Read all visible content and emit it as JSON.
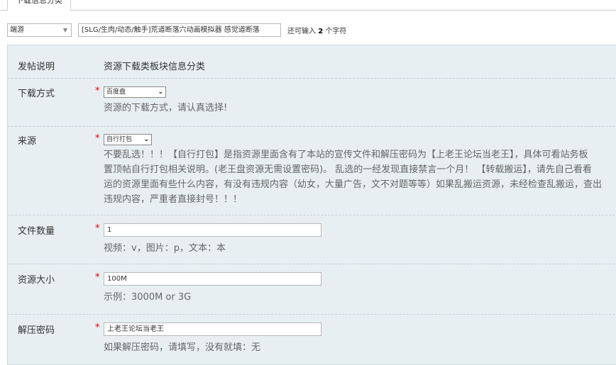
{
  "tab": {
    "label": "下载信息分类"
  },
  "title_row": {
    "type_select": "端游",
    "title_value": "[SLG/生肉/动态/触手]荒道断落穴动画模拟器 感觉道断落",
    "counter_prefix": "还可输入",
    "counter_num": "2",
    "counter_suffix": "个字符"
  },
  "form": {
    "post_desc": {
      "label": "发帖说明",
      "value": "资源下载类板块信息分类"
    },
    "download_method": {
      "label": "下载方式",
      "required": "*",
      "selected": "百度盘",
      "hint": "资源的下载方式，请认真选择!"
    },
    "source": {
      "label": "来源",
      "required": "*",
      "selected": "自行打包",
      "hint_lines": [
        "不要乱选！！！【自行打包】是指资源里面含有了本站的宣传文件和解压密码为【上老王论坛当老王】，具体可看站务板",
        "置顶帖自行打包相关说明。(老王盘资源无需设置密码)。 乱选的一经发现直接禁言一个月！ 【转载搬运】，请先自己看看",
        "运的资源里面有些什么内容，有没有违规内容（幼女，大量广告，文不对题等等）如果乱搬运资源，未经检查乱搬运，查出",
        "违规内容，严重者直接封号！！！"
      ]
    },
    "file_count": {
      "label": "文件数量",
      "required": "*",
      "value": "1",
      "hint": "视频：v，图片：p，文本：本"
    },
    "size": {
      "label": "资源大小",
      "required": "*",
      "value": "100M",
      "hint": "示例：3000M or 3G"
    },
    "password": {
      "label": "解压密码",
      "required": "*",
      "value": "上老王论坛当老王",
      "hint": "如果解压密码，请填写，没有就填：无"
    }
  }
}
